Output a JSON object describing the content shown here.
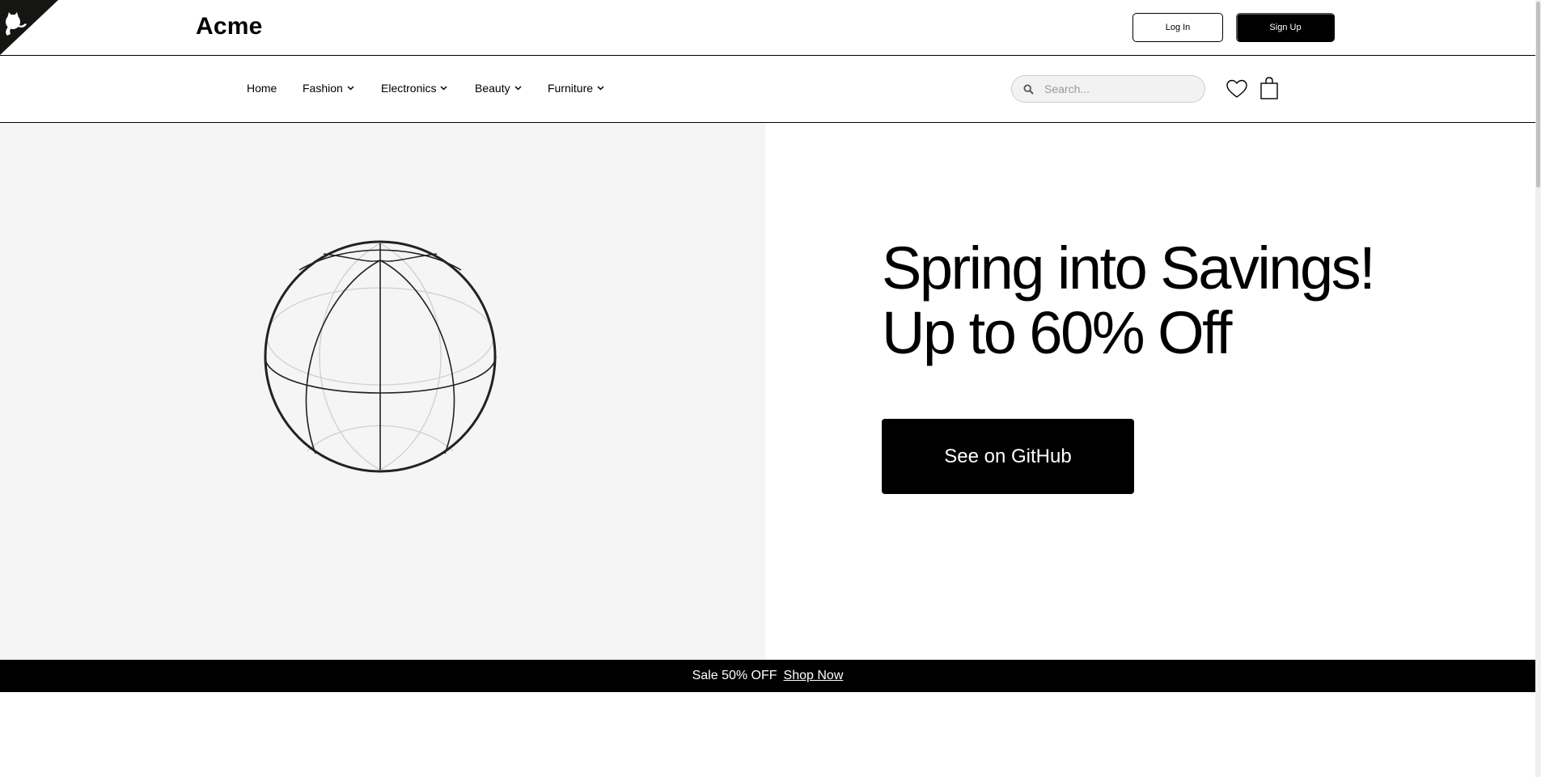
{
  "header": {
    "logo": "Acme",
    "login_label": "Log In",
    "signup_label": "Sign Up"
  },
  "nav": {
    "items": [
      {
        "label": "Home",
        "dropdown": false
      },
      {
        "label": "Fashion",
        "dropdown": true
      },
      {
        "label": "Electronics",
        "dropdown": true
      },
      {
        "label": "Beauty",
        "dropdown": true
      },
      {
        "label": "Furniture",
        "dropdown": true
      }
    ],
    "search_placeholder": "Search...",
    "search_value": "",
    "icons": [
      "search-icon",
      "heart-icon",
      "shopping-bag-icon"
    ]
  },
  "hero": {
    "headline_line1": "Spring into Savings!",
    "headline_line2": "Up to 60% Off",
    "cta_label": "See on GitHub"
  },
  "banner": {
    "text": "Sale 50% OFF",
    "link_label": "Shop Now"
  },
  "colors": {
    "primary": "#000000",
    "hero_panel": "#f5f5f5",
    "search_bg": "#f2f2f2"
  }
}
